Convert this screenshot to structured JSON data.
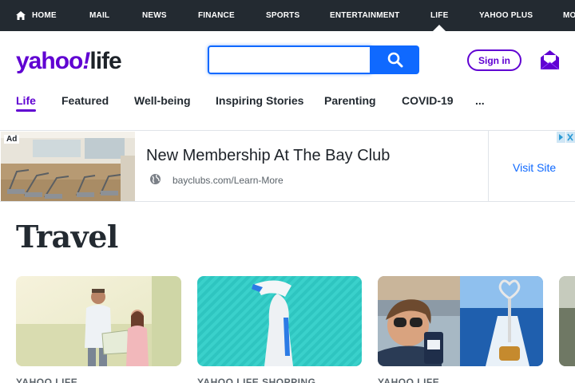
{
  "topbar": {
    "items": [
      "HOME",
      "MAIL",
      "NEWS",
      "FINANCE",
      "SPORTS",
      "ENTERTAINMENT",
      "LIFE",
      "YAHOO PLUS",
      "MO"
    ]
  },
  "header": {
    "logo_main": "yahoo",
    "logo_bang": "!",
    "logo_sub": "life",
    "search_placeholder": "",
    "signin_label": "Sign in"
  },
  "subnav": {
    "items": [
      "Life",
      "Featured",
      "Well-being",
      "Inspiring Stories",
      "Parenting",
      "COVID-19",
      "..."
    ],
    "active_index": 0
  },
  "ad": {
    "label": "Ad",
    "title": "New Membership At The Bay Club",
    "url": "bayclubs.com/Learn-More",
    "cta": "Visit Site"
  },
  "section": {
    "title": "Travel"
  },
  "cards": [
    {
      "source": "YAHOO LIFE"
    },
    {
      "source": "YAHOO LIFE SHOPPING"
    },
    {
      "source": "YAHOO LIFE"
    }
  ],
  "colors": {
    "brand": "#6001d2",
    "topbar_bg": "#232a31",
    "search_blue": "#0f69ff"
  }
}
